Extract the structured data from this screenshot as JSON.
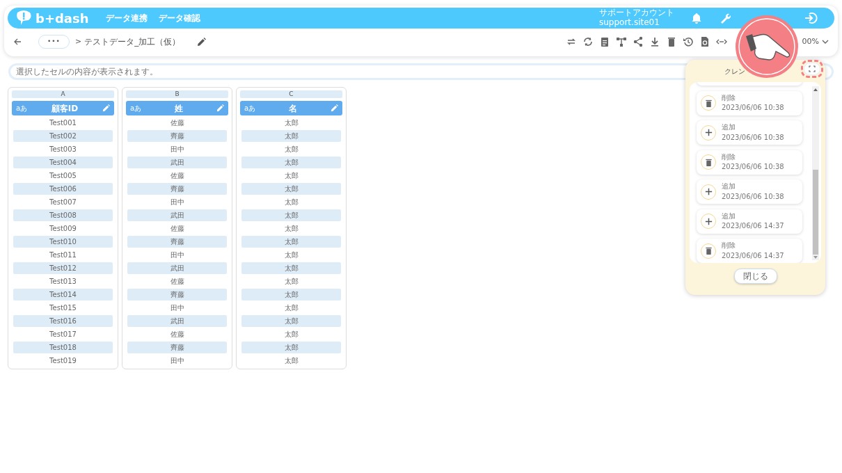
{
  "header": {
    "logo": "b+dash",
    "nav": [
      "データ連携",
      "データ確認"
    ],
    "account": {
      "name": "サポートアカウント",
      "id": "support.site01"
    }
  },
  "breadcrumb": {
    "more": "•••",
    "separator": ">",
    "title": "テストデータ_加工（仮）"
  },
  "zoom": {
    "value": "00%"
  },
  "cell_viewer": {
    "placeholder": "選択したセルの内容が表示されます。"
  },
  "columns": [
    {
      "letter": "A",
      "type_badge": "aあ",
      "header": "顧客ID",
      "cells": [
        "Test001",
        "Test002",
        "Test003",
        "Test004",
        "Test005",
        "Test006",
        "Test007",
        "Test008",
        "Test009",
        "Test010",
        "Test011",
        "Test012",
        "Test013",
        "Test014",
        "Test015",
        "Test016",
        "Test017",
        "Test018",
        "Test019"
      ]
    },
    {
      "letter": "B",
      "type_badge": "aあ",
      "header": "姓",
      "cells": [
        "佐藤",
        "齊藤",
        "田中",
        "武田",
        "佐藤",
        "齊藤",
        "田中",
        "武田",
        "佐藤",
        "齊藤",
        "田中",
        "武田",
        "佐藤",
        "齊藤",
        "田中",
        "武田",
        "佐藤",
        "齊藤",
        "田中"
      ]
    },
    {
      "letter": "C",
      "type_badge": "aあ",
      "header": "名",
      "cells": [
        "太郎",
        "太郎",
        "太郎",
        "太郎",
        "太郎",
        "太郎",
        "太郎",
        "太郎",
        "太郎",
        "太郎",
        "太郎",
        "太郎",
        "太郎",
        "太郎",
        "太郎",
        "太郎",
        "太郎",
        "太郎",
        "太郎"
      ]
    }
  ],
  "history_panel": {
    "title": "クレン",
    "items": [
      {
        "kind": "delete",
        "action": "削除",
        "time": "2023/06/06 10:38"
      },
      {
        "kind": "add",
        "action": "追加",
        "time": "2023/06/06 10:38"
      },
      {
        "kind": "delete",
        "action": "削除",
        "time": "2023/06/06 10:38"
      },
      {
        "kind": "add",
        "action": "追加",
        "time": "2023/06/06 10:38"
      },
      {
        "kind": "add",
        "action": "追加",
        "time": "2023/06/06 14:37"
      },
      {
        "kind": "delete",
        "action": "削除",
        "time": "2023/06/06 14:37"
      }
    ],
    "close": "閉じる"
  }
}
